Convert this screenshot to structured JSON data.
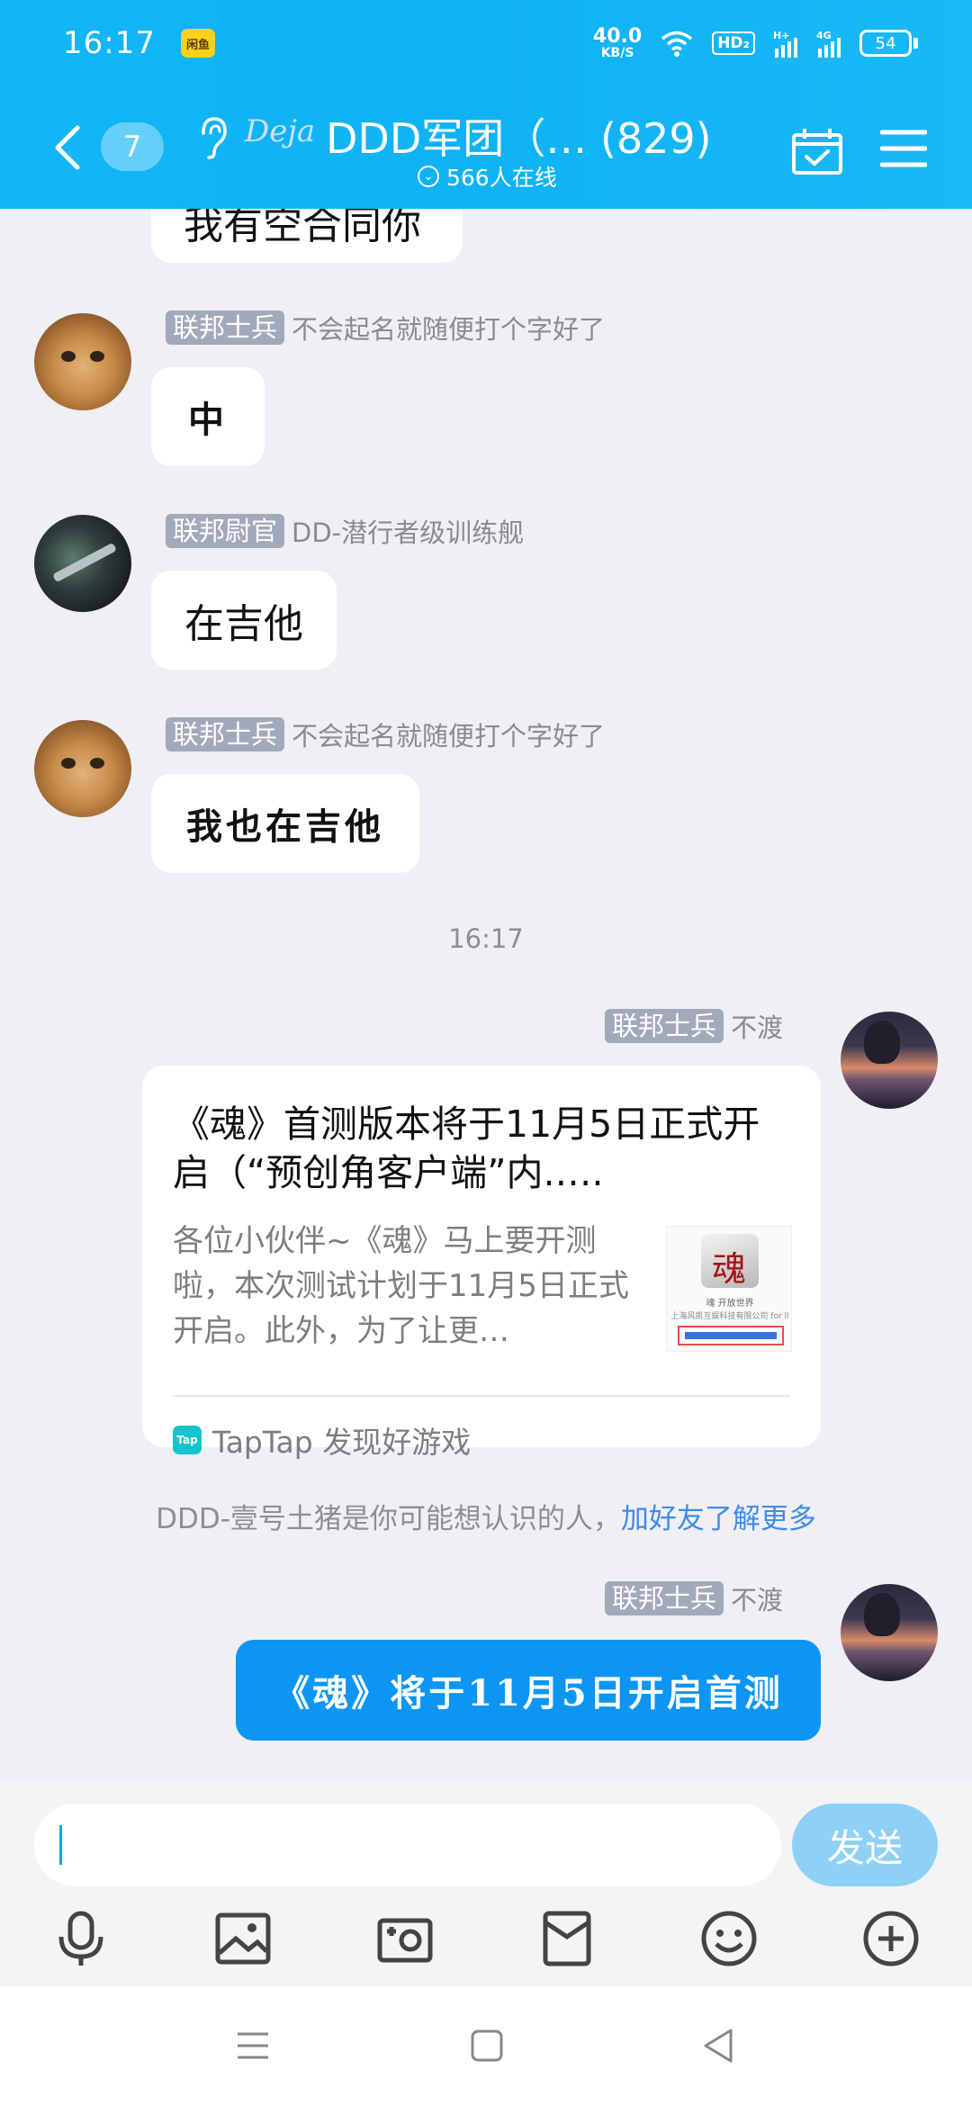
{
  "status_bar": {
    "time": "16:17",
    "app_badge": "闲鱼",
    "speed_value": "40.0",
    "speed_unit": "KB/S",
    "hd": "HD₂",
    "battery": "54"
  },
  "header": {
    "unread_count": "7",
    "logo_text": "Deja",
    "title": "DDD军团（…   (829)",
    "online": "566人在线"
  },
  "messages": [
    {
      "rank": "联邦士兵",
      "nick": "不会起名就随便打个字好了",
      "text": "中"
    },
    {
      "rank": "联邦尉官",
      "nick": "DD-潜行者级训练舰",
      "text": "在吉他"
    },
    {
      "rank": "联邦士兵",
      "nick": "不会起名就随便打个字好了",
      "text": "我也在吉他"
    }
  ],
  "partial_message": "我有空合同你",
  "timestamp": "16:17",
  "outgoing_card": {
    "rank": "联邦士兵",
    "nick": "不渡",
    "title": "《魂》首测版本将于11月5日正式开启（“预创角客户端”内.….",
    "desc": "各位小伙伴~《魂》马上要开测啦，本次测试计划于11月5日正式开启。此外，为了让更…",
    "thumb_line1": "魂 开放世界",
    "thumb_line2": "上海风凯互娱科技有限公司 for ll",
    "source_icon": "Tap",
    "source": "TapTap 发现好游戏"
  },
  "system_message": {
    "text": "DDD-壹号土猪是你可能想认识的人，",
    "link": "加好友了解更多"
  },
  "outgoing_text": {
    "rank": "联邦士兵",
    "nick": "不渡",
    "text": "《魂》将于11月5日开启首测"
  },
  "input": {
    "value": "",
    "send_label": "发送"
  },
  "toolbar_icons": [
    "microphone-icon",
    "image-icon",
    "camera-icon",
    "red-packet-icon",
    "emoji-icon",
    "plus-icon"
  ],
  "colors": {
    "accent": "#0fb2f4",
    "bubble_blue": "#0c95f2",
    "link": "#3e8be8"
  }
}
